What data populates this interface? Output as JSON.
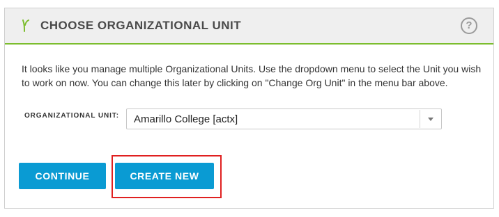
{
  "panel": {
    "title": "CHOOSE ORGANIZATIONAL UNIT",
    "help_icon_glyph": "?",
    "accent_color": "#7cbd2e",
    "description": "It looks like you manage multiple Organizational Units. Use the dropdown menu to select the Unit you wish to work on now. You can change this later by clicking on \"Change Org Unit\" in the menu bar above."
  },
  "org_unit": {
    "label": "ORGANIZATIONAL UNIT:",
    "selected": "Amarillo College [actx]"
  },
  "buttons": {
    "continue_label": "CONTINUE",
    "create_label": "CREATE NEW",
    "color": "#0a9bd3"
  },
  "annotation": {
    "highlight_color": "#e02020",
    "highlight_target": "create-new-button"
  }
}
